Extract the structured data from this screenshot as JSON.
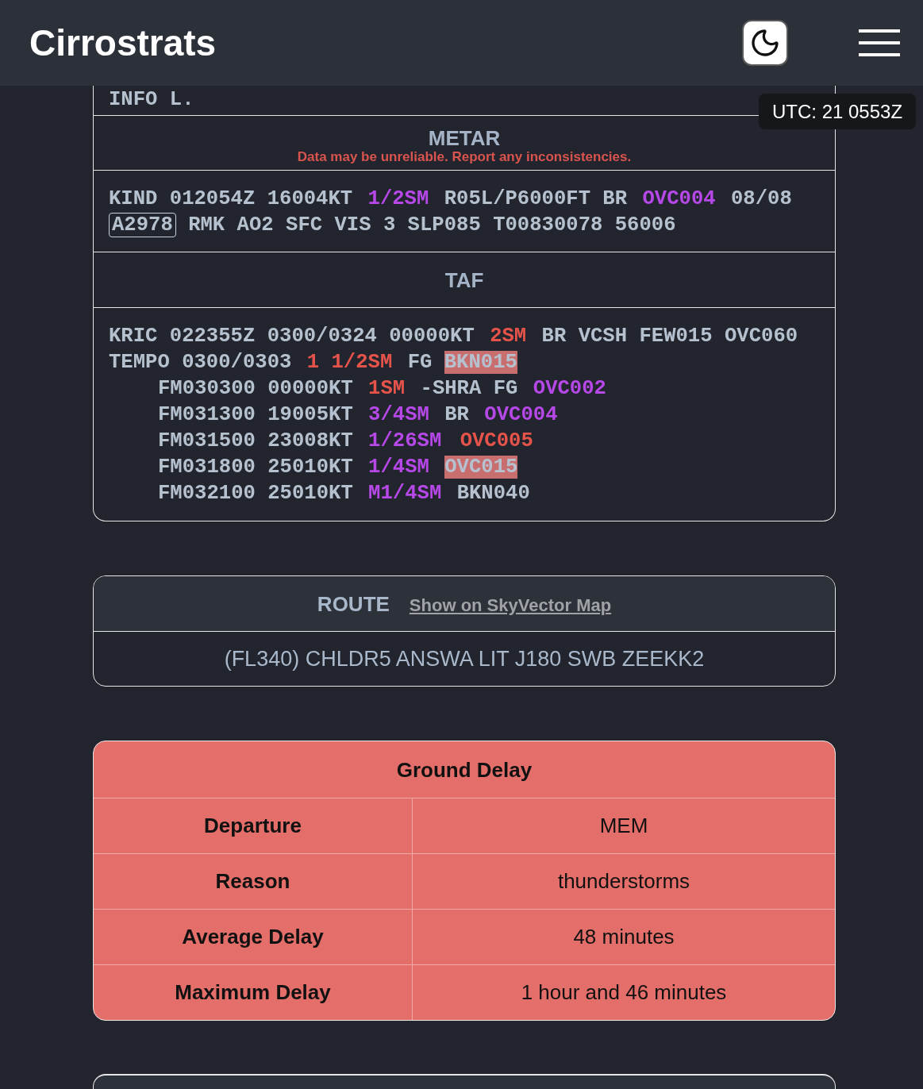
{
  "header": {
    "title": "Cirrostrats"
  },
  "utc_clock": "UTC: 21 0553Z",
  "weather": {
    "info_line": "INFO L.",
    "metar": {
      "title": "METAR",
      "warning": "Data may be unreliable. Report any inconsistencies.",
      "lines": [
        [
          {
            "text": "KIND 012054Z 16004KT",
            "kind": "plain"
          },
          {
            "text": "1/2SM",
            "kind": "lifr"
          },
          {
            "text": "R05L/P6000FT BR",
            "kind": "plain"
          },
          {
            "text": "OVC004",
            "kind": "lifr"
          },
          {
            "text": "08/08",
            "kind": "plain"
          }
        ],
        [
          {
            "text": "A2978",
            "kind": "boxed"
          },
          {
            "text": "RMK AO2 SFC VIS 3 SLP085 T00830078 56006",
            "kind": "plain"
          }
        ]
      ]
    },
    "taf": {
      "title": "TAF",
      "lines": [
        [
          {
            "text": "KRIC 022355Z 0300/0324 00000KT",
            "kind": "plain"
          },
          {
            "text": "2SM",
            "kind": "ifr"
          },
          {
            "text": "BR VCSH FEW015 OVC060",
            "kind": "plain"
          }
        ],
        [
          {
            "text": "TEMPO 0300/0303",
            "kind": "plain"
          },
          {
            "text": "1 1/2SM",
            "kind": "ifr"
          },
          {
            "text": "FG",
            "kind": "plain"
          },
          {
            "text": "BKN015",
            "kind": "marked"
          }
        ]
      ],
      "children": [
        [
          {
            "text": "FM030300 00000KT",
            "kind": "plain"
          },
          {
            "text": "1SM",
            "kind": "ifr"
          },
          {
            "text": "-SHRA FG",
            "kind": "plain"
          },
          {
            "text": "OVC002",
            "kind": "lifr"
          }
        ],
        [
          {
            "text": "FM031300 19005KT",
            "kind": "plain"
          },
          {
            "text": "3/4SM",
            "kind": "lifr"
          },
          {
            "text": "BR",
            "kind": "plain"
          },
          {
            "text": "OVC004",
            "kind": "lifr"
          }
        ],
        [
          {
            "text": "FM031500 23008KT",
            "kind": "plain"
          },
          {
            "text": "1/26SM",
            "kind": "lifr"
          },
          {
            "text": "OVC005",
            "kind": "ifr"
          }
        ],
        [
          {
            "text": "FM031800 25010KT",
            "kind": "plain"
          },
          {
            "text": "1/4SM",
            "kind": "lifr"
          },
          {
            "text": "OVC015",
            "kind": "marked"
          }
        ],
        [
          {
            "text": "FM032100 25010KT",
            "kind": "plain"
          },
          {
            "text": "M1/4SM",
            "kind": "lifr"
          },
          {
            "text": "BKN040",
            "kind": "plain"
          }
        ]
      ]
    }
  },
  "route": {
    "title": "ROUTE",
    "link": "Show on SkyVector Map",
    "text": "(FL340) CHLDR5 ANSWA LIT J180 SWB ZEEKK2"
  },
  "ground_delay": {
    "title": "Ground Delay",
    "rows": [
      {
        "label": "Departure",
        "value": "MEM"
      },
      {
        "label": "Reason",
        "value": "thunderstorms"
      },
      {
        "label": "Average Delay",
        "value": "48 minutes"
      },
      {
        "label": "Maximum Delay",
        "value": "1 hour and 46 minutes"
      }
    ]
  }
}
